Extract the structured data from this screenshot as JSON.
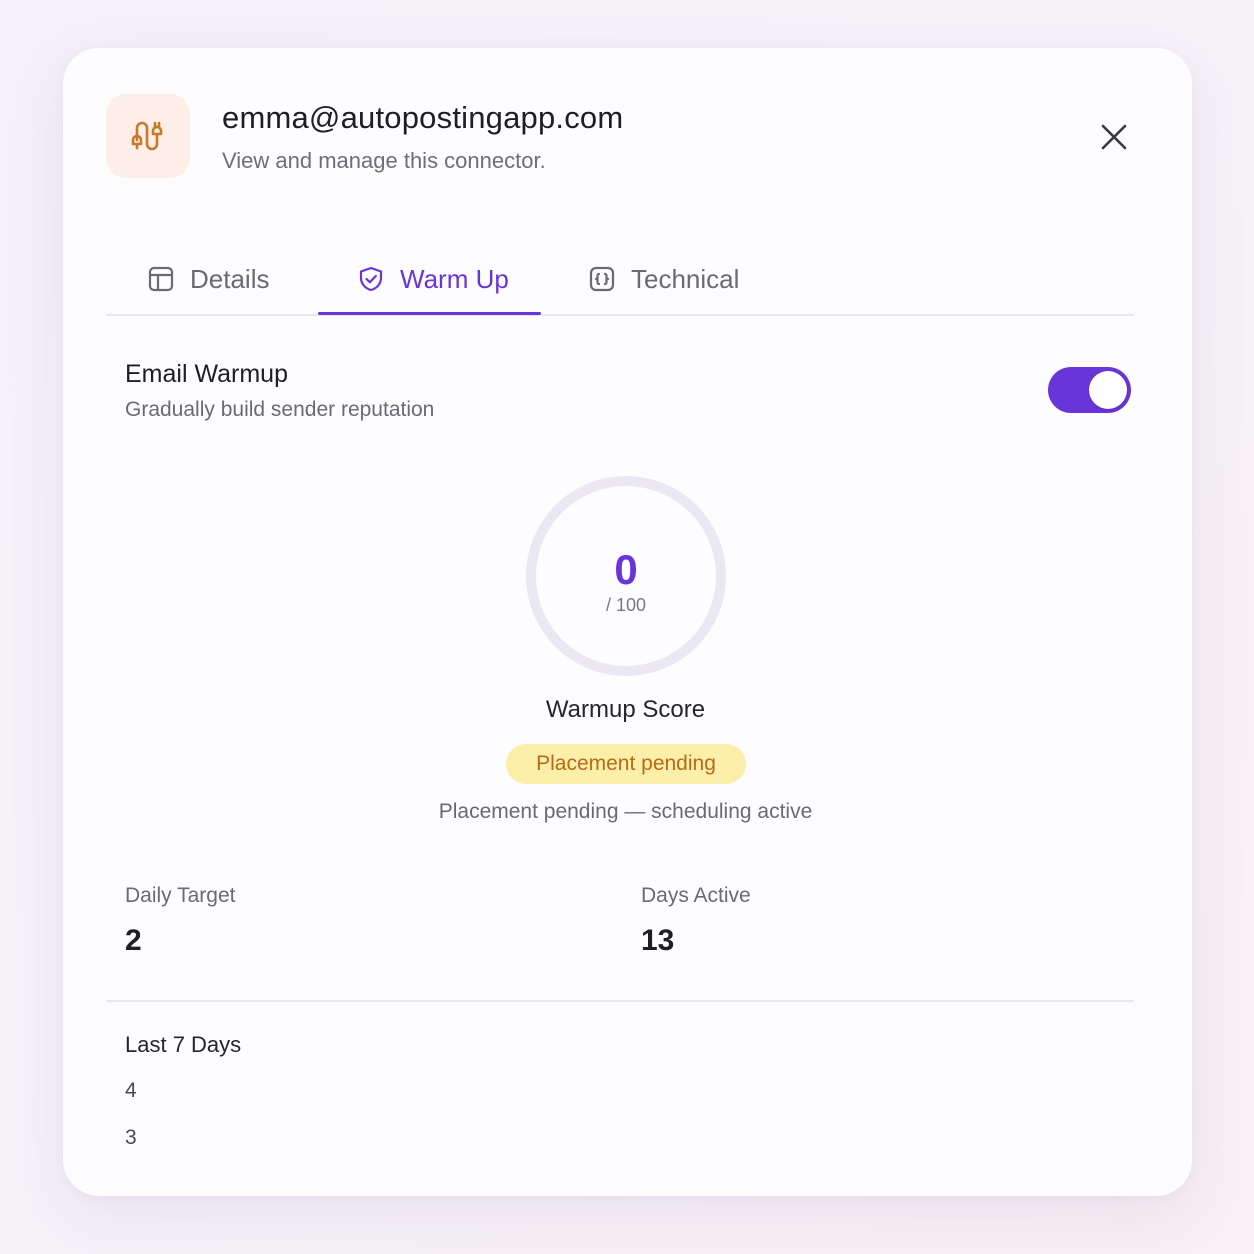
{
  "header": {
    "title": "emma@autopostingapp.com",
    "subtitle": "View and manage this connector.",
    "icon": "plug-connector-icon",
    "icon_color": "#c87a2a",
    "icon_bg": "#fdeee7"
  },
  "tabs": [
    {
      "label": "Details",
      "icon": "layout-panel-icon",
      "active": false
    },
    {
      "label": "Warm Up",
      "icon": "shield-check-icon",
      "active": true
    },
    {
      "label": "Technical",
      "icon": "code-braces-icon",
      "active": false
    }
  ],
  "warmup": {
    "title": "Email Warmup",
    "subtitle": "Gradually build sender reputation",
    "enabled": true,
    "score": "0",
    "score_max": "/ 100",
    "score_fraction": 0,
    "score_label": "Warmup Score",
    "badge": "Placement pending",
    "status": "Placement pending — scheduling active"
  },
  "stats": {
    "daily_target_label": "Daily Target",
    "daily_target_value": "2",
    "days_active_label": "Days Active",
    "days_active_value": "13"
  },
  "last7": {
    "title": "Last 7 Days",
    "values": [
      "4",
      "3"
    ]
  },
  "colors": {
    "accent": "#6a35d8",
    "badge_bg": "#fcefaa",
    "badge_text": "#b76b16",
    "gauge_track": "#ebe8f3"
  }
}
